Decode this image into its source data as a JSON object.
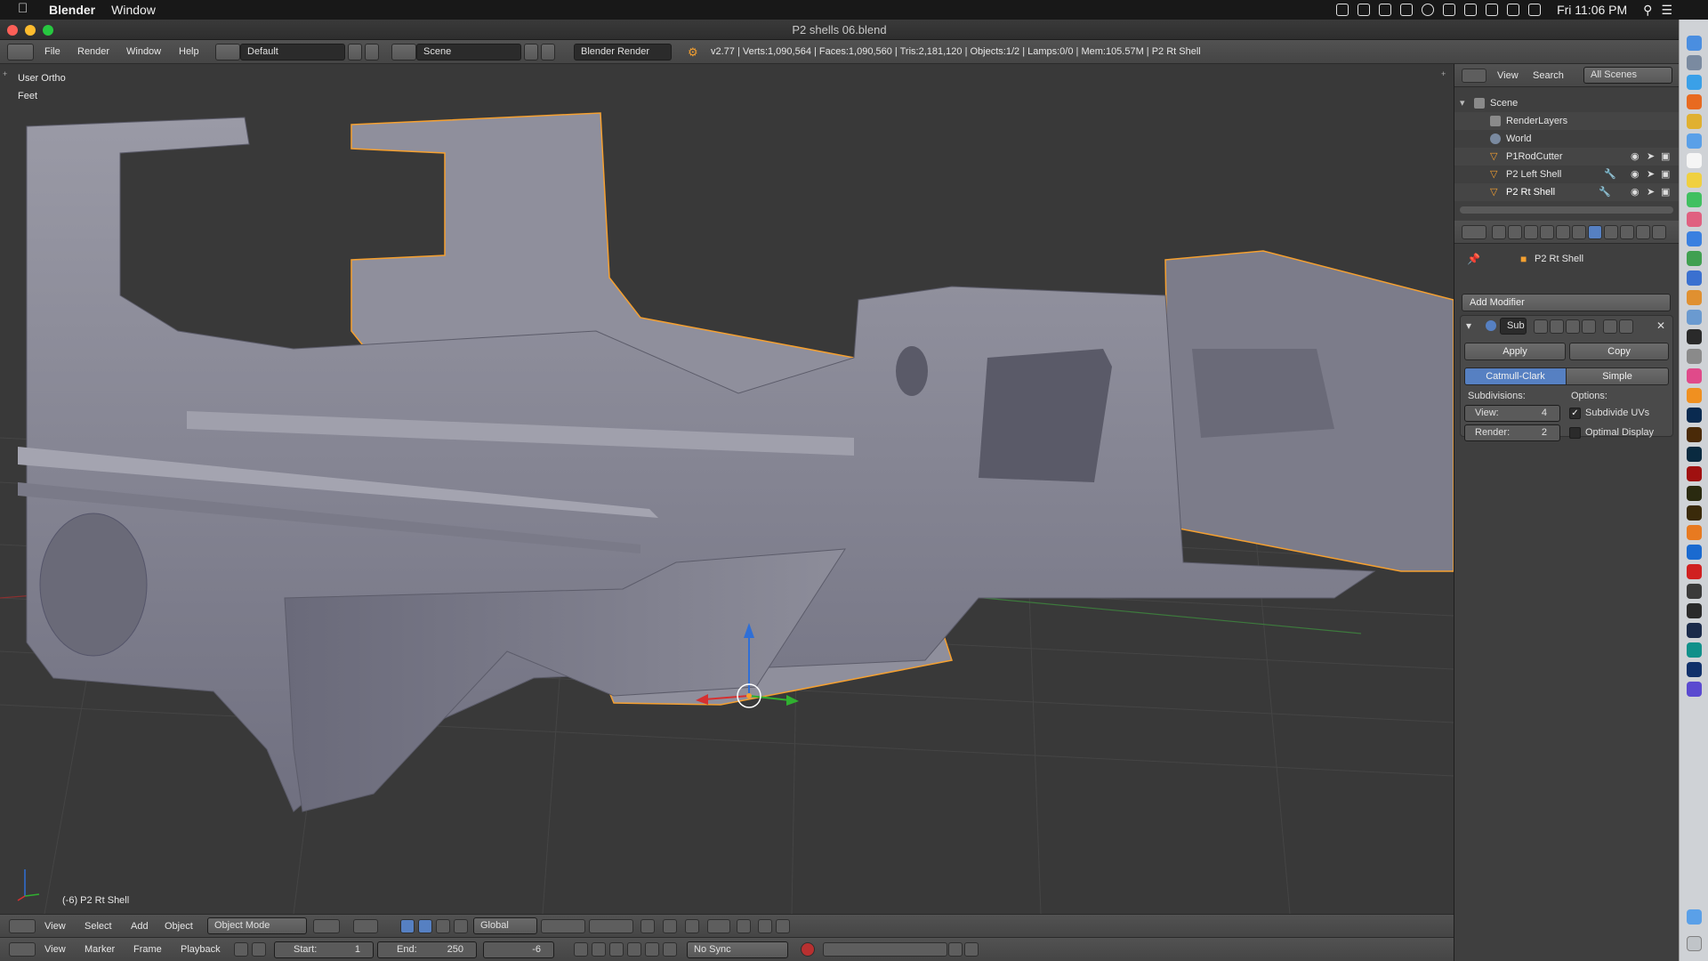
{
  "mac_menubar": {
    "app": "Blender",
    "menu_window": "Window",
    "clock": "Fri 11:06 PM"
  },
  "window": {
    "title": "P2 shells 06.blend"
  },
  "info_header": {
    "menus": [
      "File",
      "Render",
      "Window",
      "Help"
    ],
    "layout": "Default",
    "scene": "Scene",
    "engine": "Blender Render",
    "stats": "v2.77 | Verts:1,090,564 | Faces:1,090,560 | Tris:2,181,120 | Objects:1/2 | Lamps:0/0 | Mem:105.57M | P2 Rt Shell"
  },
  "viewport": {
    "view_name": "User Ortho",
    "units": "Feet",
    "object_info": "(-6) P2 Rt Shell"
  },
  "outliner": {
    "menus": [
      "View",
      "Search"
    ],
    "filter": "All Scenes",
    "items": [
      {
        "label": "Scene"
      },
      {
        "label": "RenderLayers"
      },
      {
        "label": "World"
      },
      {
        "label": "P1RodCutter"
      },
      {
        "label": "P2 Left Shell"
      },
      {
        "label": "P2 Rt Shell"
      }
    ]
  },
  "properties": {
    "object": "P2 Rt Shell",
    "add_modifier": "Add Modifier",
    "modifier_name": "Sub",
    "apply": "Apply",
    "copy": "Copy",
    "mode_catmull": "Catmull-Clark",
    "mode_simple": "Simple",
    "subdivisions_label": "Subdivisions:",
    "options_label": "Options:",
    "view_label": "View:",
    "view_value": "4",
    "render_label": "Render:",
    "render_value": "2",
    "subdivide_uvs": "Subdivide UVs",
    "optimal_display": "Optimal Display"
  },
  "view3d_header": {
    "menus": [
      "View",
      "Select",
      "Add",
      "Object"
    ],
    "mode": "Object Mode",
    "orientation": "Global"
  },
  "timeline": {
    "menus": [
      "View",
      "Marker",
      "Frame",
      "Playback"
    ],
    "start_label": "Start:",
    "start_value": "1",
    "end_label": "End:",
    "end_value": "250",
    "current_frame": "-6",
    "sync": "No Sync"
  },
  "colors": {
    "accent_blue": "#5680c2",
    "selection_orange": "#f5a030",
    "mesh": "#8d8d99"
  }
}
